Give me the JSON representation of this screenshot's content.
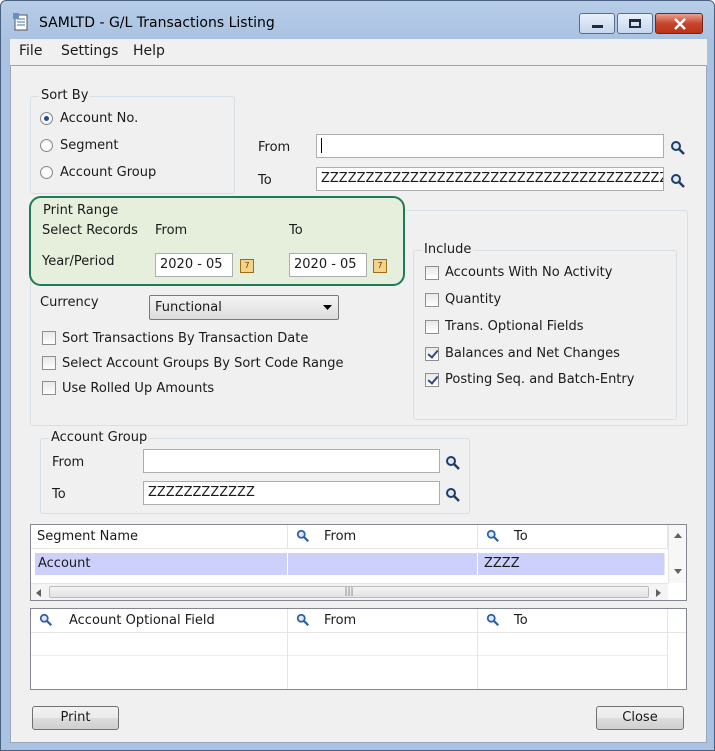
{
  "window": {
    "title": "SAMLTD - G/L Transactions Listing"
  },
  "menu": {
    "file": "File",
    "settings": "Settings",
    "help": "Help"
  },
  "sort_by": {
    "label": "Sort By",
    "options": [
      "Account No.",
      "Segment",
      "Account Group"
    ],
    "selected": "Account No.",
    "from_label": "From",
    "to_label": "To",
    "from_value": "",
    "to_value": "ZZZZZZZZZZZZZZZZZZZZZZZZZZZZZZZZZZZZZZZZZ"
  },
  "print_range": {
    "label": "Print Range",
    "select_records": "Select Records",
    "from_label": "From",
    "to_label": "To",
    "year_period": "Year/Period",
    "from_value": "2020 - 05",
    "to_value": "2020 - 05"
  },
  "currency": {
    "label": "Currency",
    "value": "Functional"
  },
  "options": [
    {
      "label": "Sort Transactions By Transaction Date",
      "checked": false
    },
    {
      "label": "Select Account Groups By Sort Code Range",
      "checked": false
    },
    {
      "label": "Use Rolled Up Amounts",
      "checked": false
    }
  ],
  "include": {
    "label": "Include",
    "items": [
      {
        "label": "Accounts With No Activity",
        "checked": false
      },
      {
        "label": "Quantity",
        "checked": false
      },
      {
        "label": "Trans. Optional Fields",
        "checked": false
      },
      {
        "label": "Balances and Net Changes",
        "checked": true
      },
      {
        "label": "Posting Seq. and Batch-Entry",
        "checked": true
      }
    ]
  },
  "account_group": {
    "label": "Account Group",
    "from_label": "From",
    "to_label": "To",
    "from_value": "",
    "to_value": "ZZZZZZZZZZZZ"
  },
  "segment_grid": {
    "headers": [
      "Segment Name",
      "From",
      "To"
    ],
    "rows": [
      {
        "name": "Account",
        "from": "",
        "to": "ZZZZ"
      }
    ]
  },
  "optional_grid": {
    "headers": [
      "Account Optional Field",
      "From",
      "To"
    ]
  },
  "buttons": {
    "print": "Print",
    "close": "Close"
  }
}
